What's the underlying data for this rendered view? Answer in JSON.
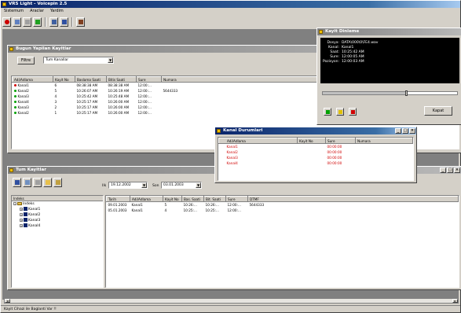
{
  "app": {
    "title": "VRS Light - Voicepin 2.5"
  },
  "menu": [
    "Sistemum",
    "Araclar",
    "Yardim"
  ],
  "channel_panel": {
    "title": "Bugun Yapilan Kayitlar",
    "filter_button": "Filtre",
    "filter_value": "Tum Kanallar",
    "columns": [
      "Adi/Adlama",
      "Kayit No",
      "Baslama Saati",
      "Bitis Saati",
      "Sure",
      "Numara"
    ],
    "rows": [
      {
        "status": "red",
        "name": "Kanal1",
        "no": "6",
        "start": "08:38:38 AM",
        "end": "08:38:38 AM",
        "dur": "12:00:...",
        "num": ""
      },
      {
        "status": "green",
        "name": "Kanal2",
        "no": "5",
        "start": "10:26:07 AM",
        "end": "10:26:19 AM",
        "dur": "12:00:...",
        "num": "5644333"
      },
      {
        "status": "green",
        "name": "Kanal3",
        "no": "4",
        "start": "10:25:42 AM",
        "end": "10:25:48 AM",
        "dur": "12:00:...",
        "num": ""
      },
      {
        "status": "green",
        "name": "Kanal4",
        "no": "3",
        "start": "10:25:17 AM",
        "end": "10:26:00 AM",
        "dur": "12:00:...",
        "num": ""
      },
      {
        "status": "green",
        "name": "Kanal3",
        "no": "2",
        "start": "10:25:17 AM",
        "end": "10:26:00 AM",
        "dur": "12:00:...",
        "num": ""
      },
      {
        "status": "green",
        "name": "Kanal2",
        "no": "1",
        "start": "10:25:17 AM",
        "end": "10:26:00 AM",
        "dur": "12:00:...",
        "num": ""
      }
    ]
  },
  "player": {
    "title": "Kayit Dinleme",
    "lines": [
      {
        "label": "Dosya:",
        "value": "DATA\\000\\0\\FE4.wav"
      },
      {
        "label": "Kanal:",
        "value": "Kanal1"
      },
      {
        "label": "Saat:",
        "value": "10:25:42 AM"
      },
      {
        "label": "Sure:",
        "value": "12:00:05 AM"
      },
      {
        "label": "Pozisyon:",
        "value": "12:00:03 AM"
      }
    ],
    "close_button": "Kapat",
    "progress": 0.62,
    "colors": {
      "play": "#00a000",
      "pause": "#e0c000",
      "stop": "#d00000"
    }
  },
  "status_popup": {
    "title": "Kanal Durumlari",
    "columns": [
      "Adi/Adlama",
      "Kayit No",
      "Sure",
      "Numara"
    ],
    "rows": [
      {
        "name": "Kanal1",
        "no": "",
        "dur": "00:00:00",
        "num": ""
      },
      {
        "name": "Kanal2",
        "no": "",
        "dur": "00:00:00",
        "num": ""
      },
      {
        "name": "Kanal3",
        "no": "",
        "dur": "00:00:00",
        "num": ""
      },
      {
        "name": "Kanal4",
        "no": "",
        "dur": "00:00:00",
        "num": ""
      }
    ]
  },
  "archive": {
    "title": "Tum Kayitlar",
    "from_label": "Ilk",
    "from_date": "19.12.2002",
    "to_label": "Son",
    "to_date": "03.01.2003",
    "tree_header": "Indeks",
    "tree_root": "Indeks",
    "tree_items": [
      "Kanal1",
      "Kanal2",
      "Kanal3",
      "Kanal4"
    ],
    "columns": [
      "Tarih",
      "Adi/Adlama",
      "Kayit No",
      "Bas. Saati",
      "Bit. Saati",
      "Sure",
      "DTMF"
    ],
    "rows": [
      {
        "date": "09.01.2003",
        "name": "Kanal1",
        "no": "5",
        "start": "10:26:...",
        "end": "10:26:...",
        "dur": "12:00:...",
        "dtmf": "5644333"
      },
      {
        "date": "05.01.2003",
        "name": "Kanal1",
        "no": "4",
        "start": "10:25:...",
        "end": "10:25:...",
        "dur": "12:00:...",
        "dtmf": ""
      }
    ]
  },
  "statusbar": {
    "text": "Kayit Cihazi ile Baglanti Var !!"
  }
}
